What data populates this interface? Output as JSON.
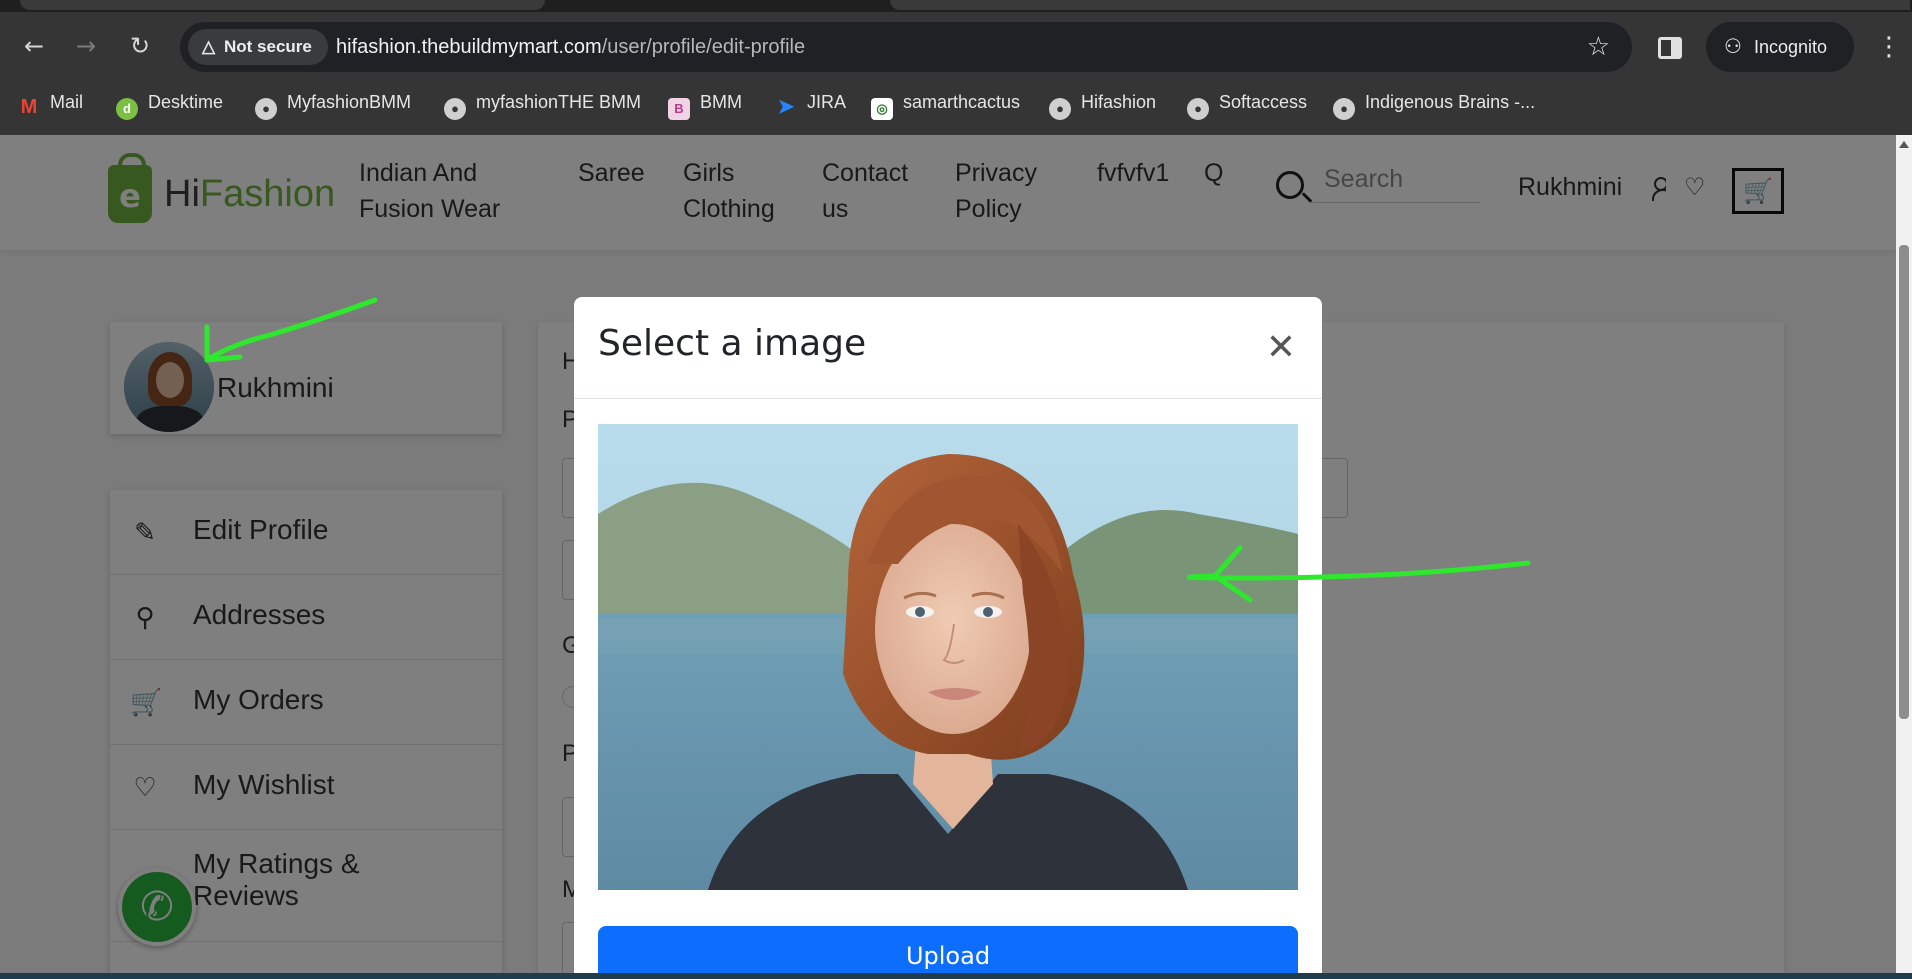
{
  "browser": {
    "security_label": "Not secure",
    "url_host": "hifashion.thebuildmymart.com",
    "url_path": "/user/profile/edit-profile",
    "incognito_label": "Incognito",
    "bookmarks": [
      {
        "label": "Mail",
        "icon": "gmail-icon"
      },
      {
        "label": "Desktime",
        "icon": "desktime-icon"
      },
      {
        "label": "MyfashionBMM",
        "icon": "globe-icon"
      },
      {
        "label": "myfashionTHE BMM",
        "icon": "globe-icon"
      },
      {
        "label": "BMM",
        "icon": "bmm-icon"
      },
      {
        "label": "JIRA",
        "icon": "jira-icon"
      },
      {
        "label": "samarthcactus",
        "icon": "cactus-icon"
      },
      {
        "label": "Hifashion",
        "icon": "globe-icon"
      },
      {
        "label": "Softaccess",
        "icon": "globe-icon"
      },
      {
        "label": "Indigenous Brains -...",
        "icon": "globe-icon"
      }
    ]
  },
  "site": {
    "logo_hi": "Hi",
    "logo_fashion": "Fashion",
    "logo_badge": "e",
    "nav": [
      {
        "line1": "Indian And",
        "line2": "Fusion Wear"
      },
      {
        "line1": "Saree",
        "line2": ""
      },
      {
        "line1": "Girls",
        "line2": "Clothing"
      },
      {
        "line1": "Contact",
        "line2": "us"
      },
      {
        "line1": "Privacy",
        "line2": "Policy"
      },
      {
        "line1": "fvfvfv1",
        "line2": ""
      },
      {
        "line1": "Q",
        "line2": ""
      }
    ],
    "search_placeholder": "Search",
    "user_name": "Rukhmini"
  },
  "sidebar": {
    "profile_name": "Rukhmini",
    "menu": [
      {
        "label": "Edit Profile",
        "icon": "edit-icon"
      },
      {
        "label": "Addresses",
        "icon": "location-pin-icon"
      },
      {
        "label": "My Orders",
        "icon": "cart-icon"
      },
      {
        "label": "My Wishlist",
        "icon": "heart-icon"
      },
      {
        "label": "My Ratings & Reviews",
        "icon": "star-icon"
      }
    ]
  },
  "form": {
    "partial_labels": [
      "H",
      "P",
      "G",
      "P",
      "M"
    ]
  },
  "modal": {
    "title": "Select a image",
    "upload_label": "Upload"
  },
  "colors": {
    "brand_green": "#6fb23f",
    "primary_blue": "#0d6efd",
    "annotation_green": "#2ee82e",
    "whatsapp_green": "#2bb741"
  }
}
